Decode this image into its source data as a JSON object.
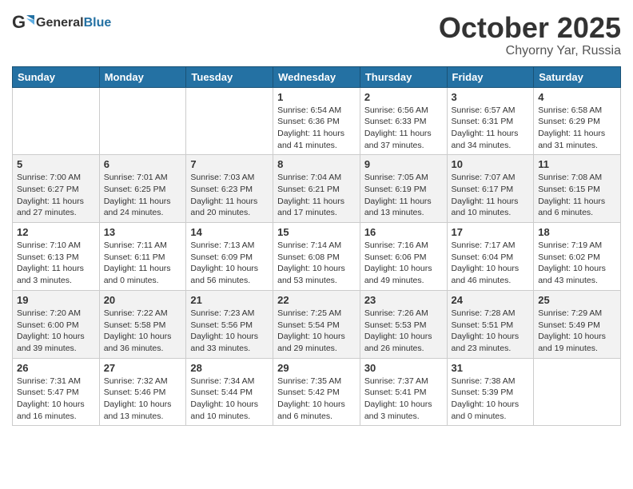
{
  "header": {
    "logo_general": "General",
    "logo_blue": "Blue",
    "month": "October 2025",
    "location": "Chyorny Yar, Russia"
  },
  "weekdays": [
    "Sunday",
    "Monday",
    "Tuesday",
    "Wednesday",
    "Thursday",
    "Friday",
    "Saturday"
  ],
  "rows": [
    {
      "shaded": false,
      "cells": [
        {
          "day": "",
          "info": ""
        },
        {
          "day": "",
          "info": ""
        },
        {
          "day": "",
          "info": ""
        },
        {
          "day": "1",
          "info": "Sunrise: 6:54 AM\nSunset: 6:36 PM\nDaylight: 11 hours\nand 41 minutes."
        },
        {
          "day": "2",
          "info": "Sunrise: 6:56 AM\nSunset: 6:33 PM\nDaylight: 11 hours\nand 37 minutes."
        },
        {
          "day": "3",
          "info": "Sunrise: 6:57 AM\nSunset: 6:31 PM\nDaylight: 11 hours\nand 34 minutes."
        },
        {
          "day": "4",
          "info": "Sunrise: 6:58 AM\nSunset: 6:29 PM\nDaylight: 11 hours\nand 31 minutes."
        }
      ]
    },
    {
      "shaded": true,
      "cells": [
        {
          "day": "5",
          "info": "Sunrise: 7:00 AM\nSunset: 6:27 PM\nDaylight: 11 hours\nand 27 minutes."
        },
        {
          "day": "6",
          "info": "Sunrise: 7:01 AM\nSunset: 6:25 PM\nDaylight: 11 hours\nand 24 minutes."
        },
        {
          "day": "7",
          "info": "Sunrise: 7:03 AM\nSunset: 6:23 PM\nDaylight: 11 hours\nand 20 minutes."
        },
        {
          "day": "8",
          "info": "Sunrise: 7:04 AM\nSunset: 6:21 PM\nDaylight: 11 hours\nand 17 minutes."
        },
        {
          "day": "9",
          "info": "Sunrise: 7:05 AM\nSunset: 6:19 PM\nDaylight: 11 hours\nand 13 minutes."
        },
        {
          "day": "10",
          "info": "Sunrise: 7:07 AM\nSunset: 6:17 PM\nDaylight: 11 hours\nand 10 minutes."
        },
        {
          "day": "11",
          "info": "Sunrise: 7:08 AM\nSunset: 6:15 PM\nDaylight: 11 hours\nand 6 minutes."
        }
      ]
    },
    {
      "shaded": false,
      "cells": [
        {
          "day": "12",
          "info": "Sunrise: 7:10 AM\nSunset: 6:13 PM\nDaylight: 11 hours\nand 3 minutes."
        },
        {
          "day": "13",
          "info": "Sunrise: 7:11 AM\nSunset: 6:11 PM\nDaylight: 11 hours\nand 0 minutes."
        },
        {
          "day": "14",
          "info": "Sunrise: 7:13 AM\nSunset: 6:09 PM\nDaylight: 10 hours\nand 56 minutes."
        },
        {
          "day": "15",
          "info": "Sunrise: 7:14 AM\nSunset: 6:08 PM\nDaylight: 10 hours\nand 53 minutes."
        },
        {
          "day": "16",
          "info": "Sunrise: 7:16 AM\nSunset: 6:06 PM\nDaylight: 10 hours\nand 49 minutes."
        },
        {
          "day": "17",
          "info": "Sunrise: 7:17 AM\nSunset: 6:04 PM\nDaylight: 10 hours\nand 46 minutes."
        },
        {
          "day": "18",
          "info": "Sunrise: 7:19 AM\nSunset: 6:02 PM\nDaylight: 10 hours\nand 43 minutes."
        }
      ]
    },
    {
      "shaded": true,
      "cells": [
        {
          "day": "19",
          "info": "Sunrise: 7:20 AM\nSunset: 6:00 PM\nDaylight: 10 hours\nand 39 minutes."
        },
        {
          "day": "20",
          "info": "Sunrise: 7:22 AM\nSunset: 5:58 PM\nDaylight: 10 hours\nand 36 minutes."
        },
        {
          "day": "21",
          "info": "Sunrise: 7:23 AM\nSunset: 5:56 PM\nDaylight: 10 hours\nand 33 minutes."
        },
        {
          "day": "22",
          "info": "Sunrise: 7:25 AM\nSunset: 5:54 PM\nDaylight: 10 hours\nand 29 minutes."
        },
        {
          "day": "23",
          "info": "Sunrise: 7:26 AM\nSunset: 5:53 PM\nDaylight: 10 hours\nand 26 minutes."
        },
        {
          "day": "24",
          "info": "Sunrise: 7:28 AM\nSunset: 5:51 PM\nDaylight: 10 hours\nand 23 minutes."
        },
        {
          "day": "25",
          "info": "Sunrise: 7:29 AM\nSunset: 5:49 PM\nDaylight: 10 hours\nand 19 minutes."
        }
      ]
    },
    {
      "shaded": false,
      "cells": [
        {
          "day": "26",
          "info": "Sunrise: 7:31 AM\nSunset: 5:47 PM\nDaylight: 10 hours\nand 16 minutes."
        },
        {
          "day": "27",
          "info": "Sunrise: 7:32 AM\nSunset: 5:46 PM\nDaylight: 10 hours\nand 13 minutes."
        },
        {
          "day": "28",
          "info": "Sunrise: 7:34 AM\nSunset: 5:44 PM\nDaylight: 10 hours\nand 10 minutes."
        },
        {
          "day": "29",
          "info": "Sunrise: 7:35 AM\nSunset: 5:42 PM\nDaylight: 10 hours\nand 6 minutes."
        },
        {
          "day": "30",
          "info": "Sunrise: 7:37 AM\nSunset: 5:41 PM\nDaylight: 10 hours\nand 3 minutes."
        },
        {
          "day": "31",
          "info": "Sunrise: 7:38 AM\nSunset: 5:39 PM\nDaylight: 10 hours\nand 0 minutes."
        },
        {
          "day": "",
          "info": ""
        }
      ]
    }
  ]
}
